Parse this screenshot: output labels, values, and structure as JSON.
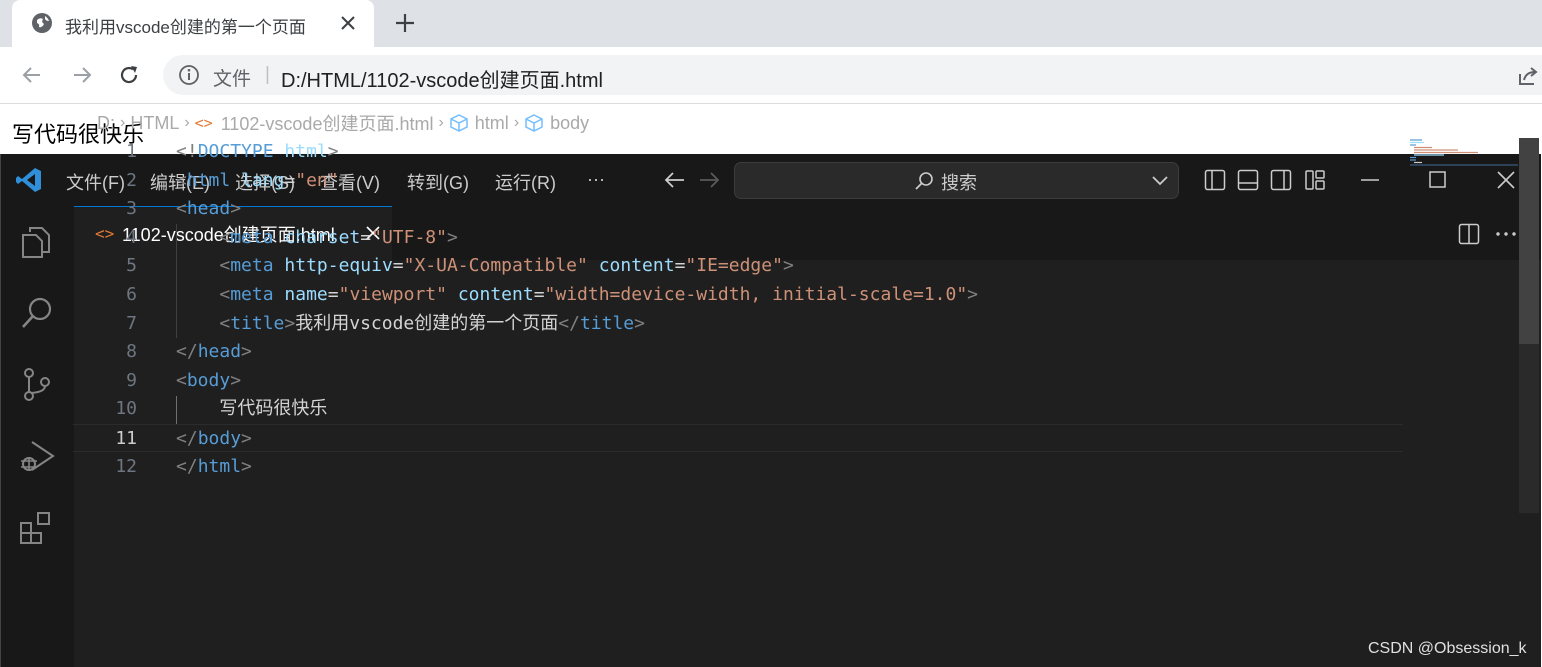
{
  "browser": {
    "tab_title": "我利用vscode创建的第一个页面",
    "address_scheme": "文件",
    "address_separator": "|",
    "address_url": "D:/HTML/1102-vscode创建页面.html"
  },
  "page": {
    "content_text": "写代码很快乐"
  },
  "vscode": {
    "menu": [
      "文件(F)",
      "编辑(E)",
      "选择(S)",
      "查看(V)",
      "转到(G)",
      "运行(R)",
      "···"
    ],
    "search_placeholder": "搜索",
    "editor_tab": {
      "icon": "<>",
      "label": "1102-vscode创建页面.html"
    },
    "breadcrumb": {
      "drive": "D:",
      "folder": "HTML",
      "file": "1102-vscode创建页面.html",
      "sym1": "html",
      "sym2": "body"
    },
    "active_line": 11,
    "code_lines": [
      {
        "n": "1",
        "tokens": [
          [
            "tg",
            "<!"
          ],
          [
            "tn",
            "DOCTYPE"
          ],
          [
            "tx",
            " "
          ],
          [
            "an",
            "html"
          ],
          [
            "tg",
            ">"
          ]
        ]
      },
      {
        "n": "2",
        "tokens": [
          [
            "tg",
            "<"
          ],
          [
            "tn",
            "html"
          ],
          [
            "tx",
            " "
          ],
          [
            "an",
            "lang"
          ],
          [
            "tx",
            "="
          ],
          [
            "av",
            "\"en\""
          ],
          [
            "tg",
            ">"
          ]
        ]
      },
      {
        "n": "3",
        "tokens": [
          [
            "tg",
            "<"
          ],
          [
            "tn",
            "head"
          ],
          [
            "tg",
            ">"
          ]
        ]
      },
      {
        "n": "4",
        "tokens": [
          [
            "tx",
            "    "
          ],
          [
            "tg",
            "<"
          ],
          [
            "tn",
            "meta"
          ],
          [
            "tx",
            " "
          ],
          [
            "an",
            "charset"
          ],
          [
            "tx",
            "="
          ],
          [
            "av",
            "\"UTF-8\""
          ],
          [
            "tg",
            ">"
          ]
        ]
      },
      {
        "n": "5",
        "tokens": [
          [
            "tx",
            "    "
          ],
          [
            "tg",
            "<"
          ],
          [
            "tn",
            "meta"
          ],
          [
            "tx",
            " "
          ],
          [
            "an",
            "http-equiv"
          ],
          [
            "tx",
            "="
          ],
          [
            "av",
            "\"X-UA-Compatible\""
          ],
          [
            "tx",
            " "
          ],
          [
            "an",
            "content"
          ],
          [
            "tx",
            "="
          ],
          [
            "av",
            "\"IE=edge\""
          ],
          [
            "tg",
            ">"
          ]
        ]
      },
      {
        "n": "6",
        "tokens": [
          [
            "tx",
            "    "
          ],
          [
            "tg",
            "<"
          ],
          [
            "tn",
            "meta"
          ],
          [
            "tx",
            " "
          ],
          [
            "an",
            "name"
          ],
          [
            "tx",
            "="
          ],
          [
            "av",
            "\"viewport\""
          ],
          [
            "tx",
            " "
          ],
          [
            "an",
            "content"
          ],
          [
            "tx",
            "="
          ],
          [
            "av",
            "\"width=device-width, initial-scale=1.0\""
          ],
          [
            "tg",
            ">"
          ]
        ]
      },
      {
        "n": "7",
        "tokens": [
          [
            "tx",
            "    "
          ],
          [
            "tg",
            "<"
          ],
          [
            "tn",
            "title"
          ],
          [
            "tg",
            ">"
          ],
          [
            "tx",
            "我利用vscode创建的第一个页面"
          ],
          [
            "tg",
            "</"
          ],
          [
            "tn",
            "title"
          ],
          [
            "tg",
            ">"
          ]
        ]
      },
      {
        "n": "8",
        "tokens": [
          [
            "tg",
            "</"
          ],
          [
            "tn",
            "head"
          ],
          [
            "tg",
            ">"
          ]
        ]
      },
      {
        "n": "9",
        "tokens": [
          [
            "tg",
            "<"
          ],
          [
            "tn",
            "body"
          ],
          [
            "tg",
            ">"
          ]
        ]
      },
      {
        "n": "10",
        "tokens": [
          [
            "tx",
            "    写代码很快乐"
          ]
        ]
      },
      {
        "n": "11",
        "tokens": [
          [
            "tg",
            "</"
          ],
          [
            "tn",
            "body"
          ],
          [
            "tg",
            ">"
          ]
        ]
      },
      {
        "n": "12",
        "tokens": [
          [
            "tg",
            "</"
          ],
          [
            "tn",
            "html"
          ],
          [
            "tg",
            ">"
          ]
        ]
      }
    ]
  },
  "watermark": "CSDN @Obsession_k",
  "colors": {
    "accent": "#0078d4",
    "tag": "#569cd6",
    "attr": "#9cdcfe",
    "string": "#ce9178",
    "bracket": "#808080"
  }
}
